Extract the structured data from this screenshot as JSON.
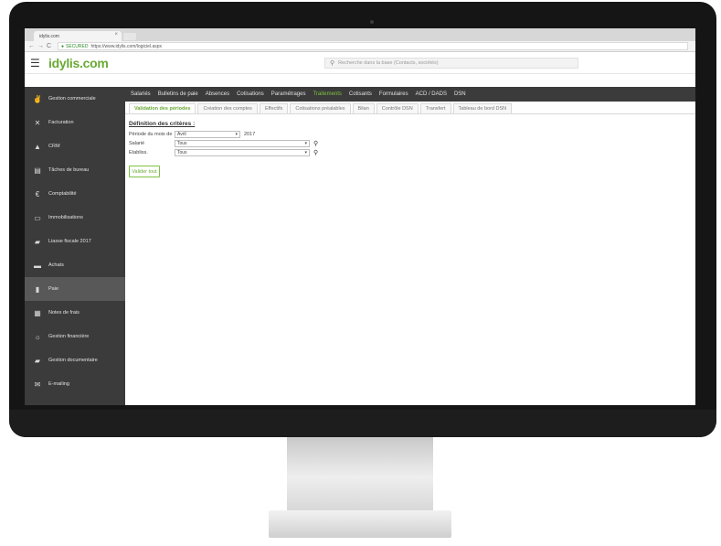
{
  "browser": {
    "tab_title": "idylis.com",
    "tab_close": "×",
    "back": "←",
    "forward": "→",
    "reload": "C",
    "secure_label": "SECURED",
    "url": "https://www.idylis.com/logiciel.aspx"
  },
  "app": {
    "logo": "idylis.com",
    "menu_icon": "hamburger-icon",
    "search_placeholder": "Recherche dans la base (Contacts, sociétés)",
    "search_icon": "search-icon"
  },
  "topnav": {
    "items": [
      "Salariés",
      "Bulletins de paie",
      "Absences",
      "Cotisations",
      "Paramétrages",
      "Traitements",
      "Cotisants",
      "Formulaires",
      "ACD / DADS",
      "DSN"
    ],
    "active_index": 5
  },
  "sidebar": {
    "items": [
      {
        "label": "Gestion commerciale",
        "icon": "handshake-icon"
      },
      {
        "label": "Facturation",
        "icon": "tools-icon"
      },
      {
        "label": "CRM",
        "icon": "user-icon"
      },
      {
        "label": "Tâches de bureau",
        "icon": "document-icon"
      },
      {
        "label": "Comptabilité",
        "icon": "euro-icon"
      },
      {
        "label": "Immobilisations",
        "icon": "monitor-icon"
      },
      {
        "label": "Liasse fiscale 2017",
        "icon": "folder-icon"
      },
      {
        "label": "Achats",
        "icon": "cart-icon"
      },
      {
        "label": "Paie",
        "icon": "pay-icon"
      },
      {
        "label": "Notes de frais",
        "icon": "receipt-icon"
      },
      {
        "label": "Gestion financière",
        "icon": "finance-icon"
      },
      {
        "label": "Gestion documentaire",
        "icon": "folder-open-icon"
      },
      {
        "label": "E-mailing",
        "icon": "mail-icon"
      }
    ],
    "active_index": 8
  },
  "subtabs": {
    "items": [
      "Validation des périodes",
      "Création des comptes",
      "Effectifs",
      "Cotisations préalables",
      "Bilan",
      "Contrôle DSN",
      "Transfert",
      "Tableau de bord DSN"
    ],
    "active_index": 0
  },
  "criteria": {
    "title": "Définition des critères :",
    "period": {
      "label": "Période du mois de",
      "month": "Avril",
      "year": "2017"
    },
    "salarie": {
      "label": "Salarié",
      "value": "Tous"
    },
    "etablissement": {
      "label": "Etabliss.",
      "value": "Tous"
    },
    "validate_label": "Valider tout"
  }
}
